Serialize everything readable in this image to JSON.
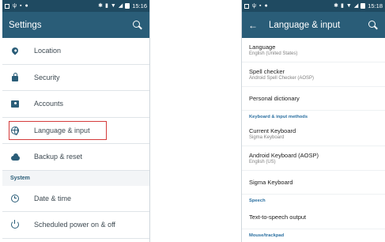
{
  "left_phone": {
    "status_time": "15:16",
    "title": "Settings",
    "items": [
      {
        "label": "Location",
        "icon": "location-icon"
      },
      {
        "label": "Security",
        "icon": "lock-icon"
      },
      {
        "label": "Accounts",
        "icon": "accounts-icon"
      },
      {
        "label": "Language & input",
        "icon": "globe-icon"
      },
      {
        "label": "Backup & reset",
        "icon": "cloud-icon"
      }
    ],
    "section_system": "System",
    "system_items": [
      {
        "label": "Date & time",
        "icon": "clock-icon"
      },
      {
        "label": "Scheduled power on & off",
        "icon": "power-icon"
      }
    ],
    "highlight_color": "#d43b3b"
  },
  "right_phone": {
    "status_time": "15:18",
    "title": "Language & input",
    "items_top": [
      {
        "title": "Language",
        "subtitle": "English (United States)"
      },
      {
        "title": "Spell checker",
        "subtitle": "Android Spell Checker (AOSP)"
      },
      {
        "title": "Personal dictionary",
        "subtitle": ""
      }
    ],
    "section_keyboard": "Keyboard & input methods",
    "keyboard_items": [
      {
        "title": "Current Keyboard",
        "subtitle": "Sigma Keyboard"
      },
      {
        "title": "Android Keyboard (AOSP)",
        "subtitle": "English (US)"
      },
      {
        "title": "Sigma Keyboard",
        "subtitle": ""
      }
    ],
    "section_speech": "Speech",
    "speech_items": [
      {
        "title": "Text-to-speech output",
        "subtitle": ""
      }
    ],
    "section_mouse": "Mouse/trackpad"
  },
  "colors": {
    "statusbar": "#1f4a61",
    "appbar": "#2a5d78",
    "accent": "#2a6fa0"
  }
}
